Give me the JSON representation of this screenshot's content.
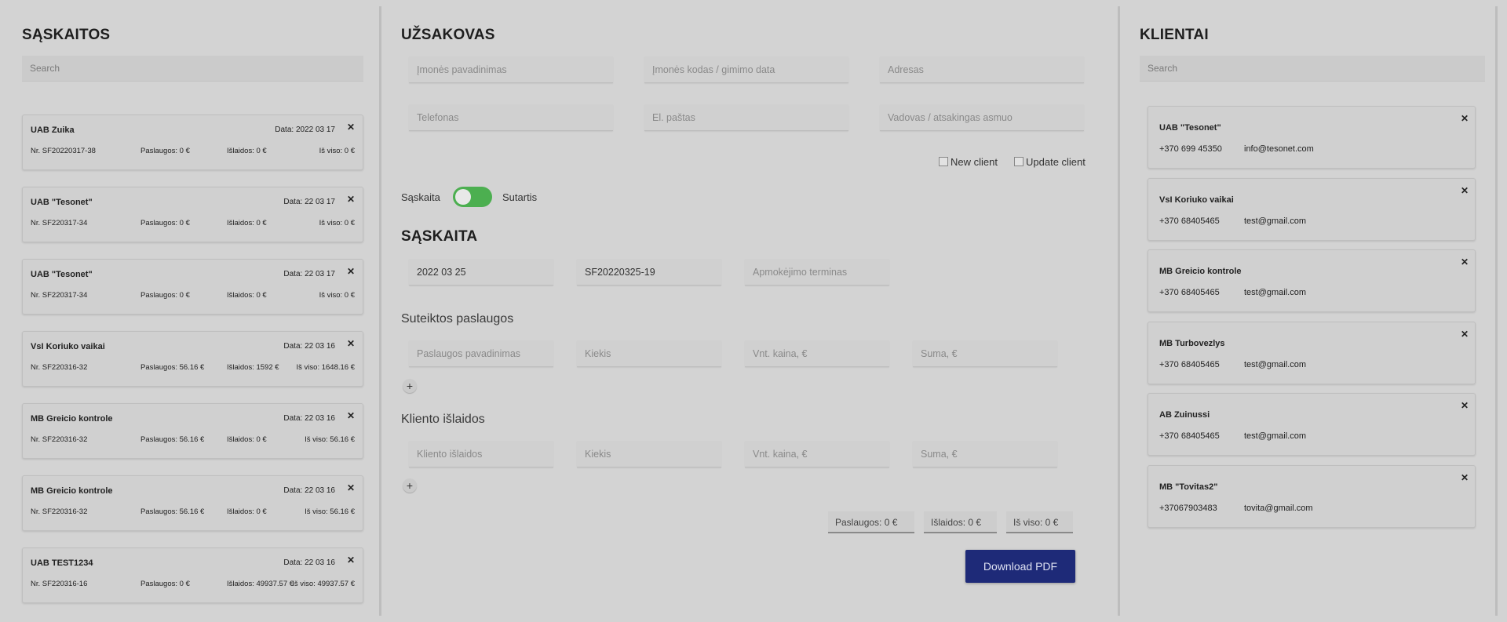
{
  "invoices_panel": {
    "title": "SĄSKAITOS",
    "search_placeholder": "Search",
    "items": [
      {
        "name": "UAB Zuika",
        "date": "Data: 2022 03 17",
        "nr": "Nr. SF20220317-38",
        "services": "Paslaugos: 0 €",
        "expenses": "Išlaidos: 0 €",
        "total": "Iš viso: 0 €"
      },
      {
        "name": "UAB \"Tesonet\"",
        "date": "Data: 22 03 17",
        "nr": "Nr. SF220317-34",
        "services": "Paslaugos: 0 €",
        "expenses": "Išlaidos: 0 €",
        "total": "Iš viso: 0 €"
      },
      {
        "name": "UAB \"Tesonet\"",
        "date": "Data: 22 03 17",
        "nr": "Nr. SF220317-34",
        "services": "Paslaugos: 0 €",
        "expenses": "Išlaidos: 0 €",
        "total": "Iš viso: 0 €"
      },
      {
        "name": "VsI Koriuko vaikai",
        "date": "Data: 22 03 16",
        "nr": "Nr. SF220316-32",
        "services": "Paslaugos: 56.16 €",
        "expenses": "Išlaidos: 1592 €",
        "total": "Iš viso: 1648.16 €"
      },
      {
        "name": "MB Greicio kontrole",
        "date": "Data: 22 03 16",
        "nr": "Nr. SF220316-32",
        "services": "Paslaugos: 56.16 €",
        "expenses": "Išlaidos: 0 €",
        "total": "Iš viso: 56.16 €"
      },
      {
        "name": "MB Greicio kontrole",
        "date": "Data: 22 03 16",
        "nr": "Nr. SF220316-32",
        "services": "Paslaugos: 56.16 €",
        "expenses": "Išlaidos: 0 €",
        "total": "Iš viso: 56.16 €"
      },
      {
        "name": "UAB TEST1234",
        "date": "Data: 22 03 16",
        "nr": "Nr. SF220316-16",
        "services": "Paslaugos: 0 €",
        "expenses": "Išlaidos: 49937.57 €",
        "total": "Iš viso: 49937.57 €"
      }
    ]
  },
  "customer_panel": {
    "title": "UŽSAKOVAS",
    "fields": {
      "company_name": "Įmonės pavadinimas",
      "company_code": "Įmonės kodas / gimimo data",
      "address": "Adresas",
      "phone": "Telefonas",
      "email": "El. paštas",
      "manager": "Vadovas / atsakingas asmuo"
    },
    "new_client": "New client",
    "update_client": "Update client",
    "toggle_left": "Sąskaita",
    "toggle_right": "Sutartis",
    "invoice_title": "SĄSKAITA",
    "invoice_date": "2022 03 25",
    "invoice_number": "SF20220325-19",
    "payment_term": "Apmokėjimo terminas",
    "services_title": "Suteiktos paslaugos",
    "services_fields": {
      "name": "Paslaugos pavadinimas",
      "qty": "Kiekis",
      "unit_price": "Vnt. kaina, €",
      "sum": "Suma, €"
    },
    "expenses_title": "Kliento išlaidos",
    "expenses_fields": {
      "name": "Kliento išlaidos",
      "qty": "Kiekis",
      "unit_price": "Vnt. kaina, €",
      "sum": "Suma, €"
    },
    "plus": "+",
    "totals": {
      "services": "Paslaugos: 0 €",
      "expenses": "Išlaidos: 0 €",
      "total": "Iš viso: 0 €"
    },
    "download_label": "Download PDF"
  },
  "clients_panel": {
    "title": "KLIENTAI",
    "search_placeholder": "Search",
    "items": [
      {
        "name": "UAB \"Tesonet\"",
        "phone": "+370 699 45350",
        "email": "info@tesonet.com"
      },
      {
        "name": "VsI Koriuko vaikai",
        "phone": "+370 68405465",
        "email": "test@gmail.com"
      },
      {
        "name": "MB Greicio kontrole",
        "phone": "+370 68405465",
        "email": "test@gmail.com"
      },
      {
        "name": "MB Turbovezlys",
        "phone": "+370 68405465",
        "email": "test@gmail.com"
      },
      {
        "name": "AB Zuinussi",
        "phone": "+370 68405465",
        "email": "test@gmail.com"
      },
      {
        "name": "MB \"Tovitas2\"",
        "phone": "+37067903483",
        "email": "tovita@gmail.com"
      }
    ]
  },
  "icons": {
    "close": "close-icon",
    "plus": "plus-icon"
  },
  "colors": {
    "accent": "#1e2a78",
    "toggle": "#4caf50",
    "background": "#d3d3d3"
  }
}
